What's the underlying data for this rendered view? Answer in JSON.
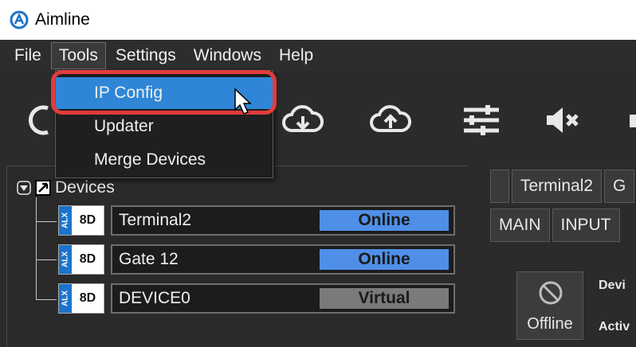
{
  "window": {
    "title": "Aimline"
  },
  "menubar": {
    "items": [
      "File",
      "Tools",
      "Settings",
      "Windows",
      "Help"
    ]
  },
  "dropdown": {
    "items": [
      "IP Config",
      "Updater",
      "Merge Devices"
    ]
  },
  "toolbar": {
    "icons": [
      "refresh-icon",
      "cloud-download-icon",
      "cloud-upload-icon",
      "sliders-icon",
      "mute-icon"
    ]
  },
  "tree": {
    "header": "Devices",
    "devices": [
      {
        "brand": "ALX",
        "code": "8D",
        "name": "Terminal2",
        "status": "Online",
        "status_color": "#4f8fe8"
      },
      {
        "brand": "ALX",
        "code": "8D",
        "name": "Gate 12",
        "status": "Online",
        "status_color": "#4f8fe8"
      },
      {
        "brand": "ALX",
        "code": "8D",
        "name": "DEVICE0",
        "status": "Virtual",
        "status_color": "#7a7a7a"
      }
    ]
  },
  "right_panel": {
    "device_tabs": [
      "",
      "Terminal2",
      "G"
    ],
    "section_tabs": [
      "MAIN",
      "INPUT"
    ],
    "offline_button": "Offline",
    "labels": [
      "Devi",
      "Activ"
    ]
  },
  "colors": {
    "accent": "#2f86d6",
    "highlight_outline": "#e23c3c",
    "online": "#4f8fe8",
    "virtual": "#7a7a7a"
  }
}
